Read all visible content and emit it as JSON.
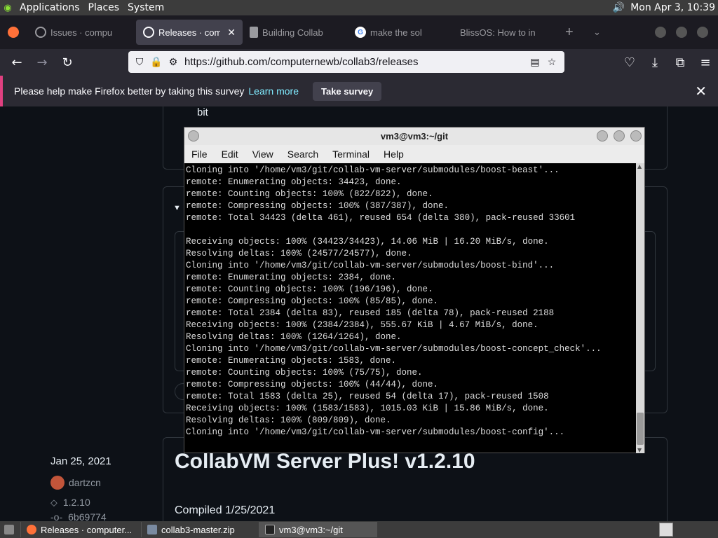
{
  "top_panel": {
    "menus": [
      "Applications",
      "Places",
      "System"
    ],
    "clock": "Mon Apr  3, 10:39"
  },
  "tabs": [
    {
      "label": "Issues · compu",
      "icon": "github-icon",
      "active": false
    },
    {
      "label": "Releases · comp",
      "icon": "github-icon",
      "active": true
    },
    {
      "label": "Building Collab",
      "icon": "book-icon",
      "active": false
    },
    {
      "label": "make the sol",
      "icon": "google-icon",
      "active": false
    },
    {
      "label": "BlissOS: How to in",
      "icon": "",
      "active": false
    }
  ],
  "navbar": {
    "url": "https://github.com/computernewb/collab3/releases"
  },
  "survey": {
    "message": "Please help make Firefox better by taking this survey",
    "learn_more": "Learn more",
    "take_survey": "Take survey"
  },
  "page": {
    "bit_text": "bit",
    "release_date": "Jan 25, 2021",
    "author": "dartzcn",
    "tag": "1.2.10",
    "commit": "6b69774",
    "release_title": "CollabVM Server Plus! v1.2.10",
    "compiled": "Compiled 1/25/2021"
  },
  "terminal": {
    "title": "vm3@vm3:~/git",
    "menus": [
      "File",
      "Edit",
      "View",
      "Search",
      "Terminal",
      "Help"
    ],
    "lines": [
      "Cloning into '/home/vm3/git/collab-vm-server/submodules/boost-beast'...",
      "remote: Enumerating objects: 34423, done.",
      "remote: Counting objects: 100% (822/822), done.",
      "remote: Compressing objects: 100% (387/387), done.",
      "remote: Total 34423 (delta 461), reused 654 (delta 380), pack-reused 33601",
      "",
      "Receiving objects: 100% (34423/34423), 14.06 MiB | 16.20 MiB/s, done.",
      "Resolving deltas: 100% (24577/24577), done.",
      "Cloning into '/home/vm3/git/collab-vm-server/submodules/boost-bind'...",
      "remote: Enumerating objects: 2384, done.",
      "remote: Counting objects: 100% (196/196), done.",
      "remote: Compressing objects: 100% (85/85), done.",
      "remote: Total 2384 (delta 83), reused 185 (delta 78), pack-reused 2188",
      "Receiving objects: 100% (2384/2384), 555.67 KiB | 4.67 MiB/s, done.",
      "Resolving deltas: 100% (1264/1264), done.",
      "Cloning into '/home/vm3/git/collab-vm-server/submodules/boost-concept_check'...",
      "remote: Enumerating objects: 1583, done.",
      "remote: Counting objects: 100% (75/75), done.",
      "remote: Compressing objects: 100% (44/44), done.",
      "remote: Total 1583 (delta 25), reused 54 (delta 17), pack-reused 1508",
      "Receiving objects: 100% (1583/1583), 1015.03 KiB | 15.86 MiB/s, done.",
      "Resolving deltas: 100% (809/809), done.",
      "Cloning into '/home/vm3/git/collab-vm-server/submodules/boost-config'..."
    ]
  },
  "taskbar": {
    "items": [
      {
        "label": "Releases · computer...",
        "icon": "firefox-icon",
        "active": false
      },
      {
        "label": "collab3-master.zip",
        "icon": "archive-icon",
        "active": false
      },
      {
        "label": "vm3@vm3:~/git",
        "icon": "terminal-icon",
        "active": true
      }
    ]
  }
}
